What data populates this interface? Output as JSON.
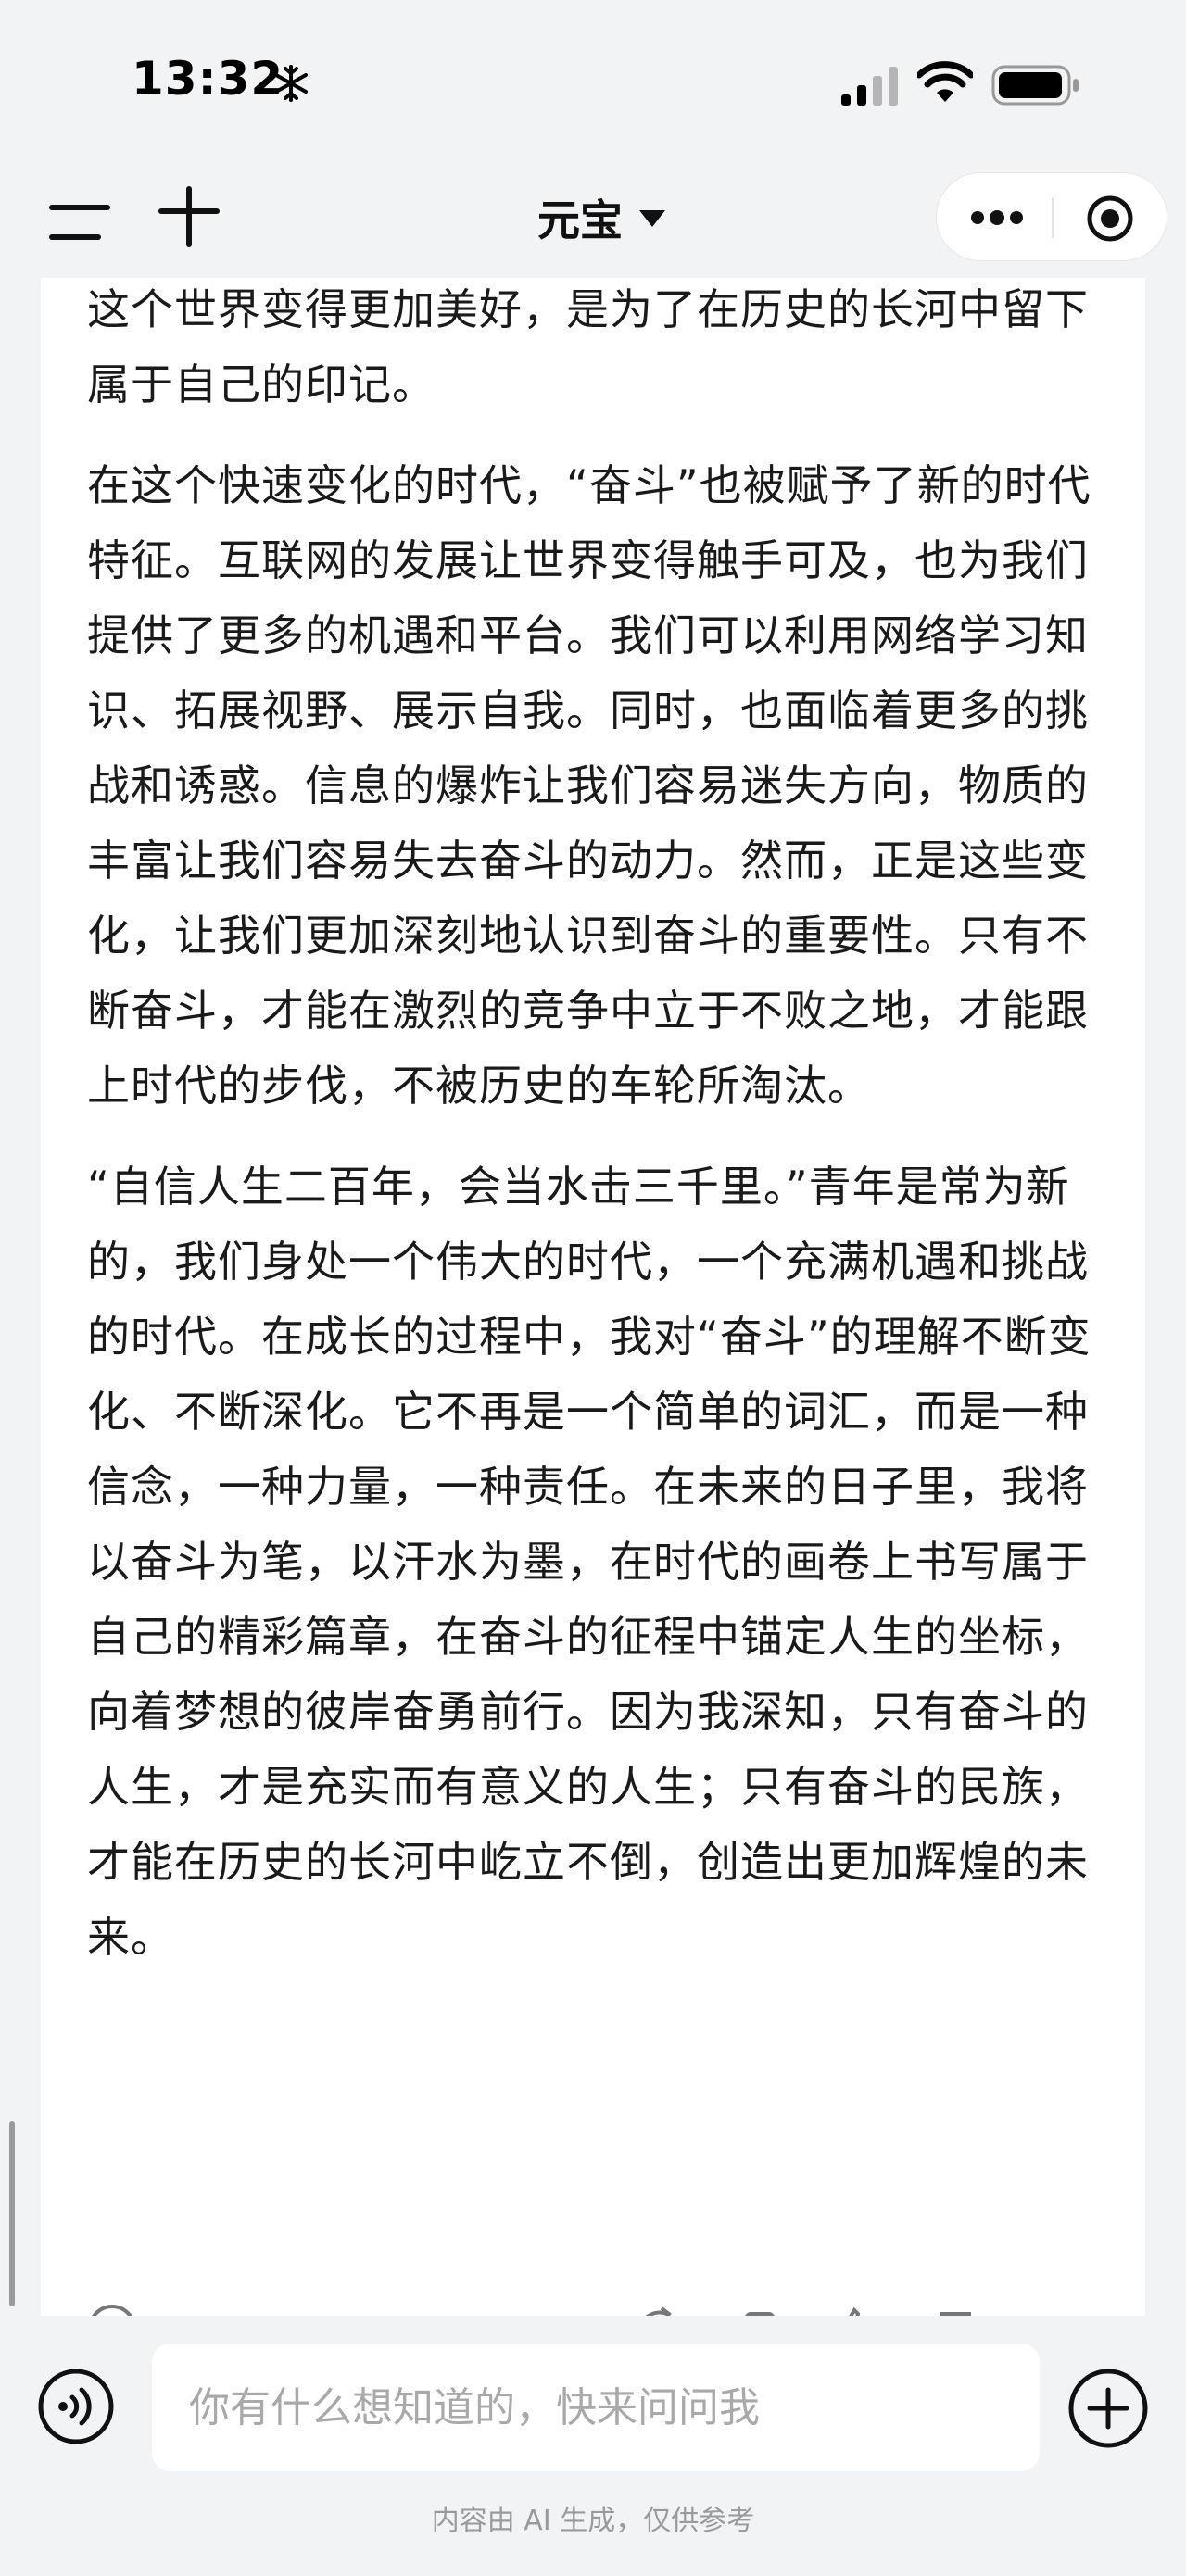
{
  "status_bar": {
    "time": "13:32",
    "snow_icon": "snowflake-icon",
    "signal_icon": "signal-icon",
    "wifi_icon": "wifi-icon",
    "battery_icon": "battery-icon"
  },
  "header": {
    "title": "元宝",
    "menu_icon": "menu-icon",
    "new_chat_icon": "plus-icon",
    "more_icon": "more-icon",
    "target_icon": "target-icon"
  },
  "content": {
    "paragraphs": [
      "这个世界变得更加美好，是为了在历史的长河中留下属于自己的印记。",
      "在这个快速变化的时代，“奋斗”也被赋予了新的时代特征。互联网的发展让世界变得触手可及，也为我们提供了更多的机遇和平台。我们可以利用网络学习知识、拓展视野、展示自我。同时，也面临着更多的挑战和诱惑。信息的爆炸让我们容易迷失方向，物质的丰富让我们容易失去奋斗的动力。然而，正是这些变化，让我们更加深刻地认识到奋斗的重要性。只有不断奋斗，才能在激烈的竞争中立于不败之地，才能跟上时代的步伐，不被历史的车轮所淘汰。",
      "“自信人生二百年，会当水击三千里。”青年是常为新的，我们身处一个伟大的时代，一个充满机遇和挑战的时代。在成长的过程中，我对“奋斗”的理解不断变化、不断深化。它不再是一个简单的词汇，而是一种信念，一种力量，一种责任。在未来的日子里，我将以奋斗为笔，以汗水为墨，在时代的画卷上书写属于自己的精彩篇章，在奋斗的征程中锚定人生的坐标，向着梦想的彼岸奋勇前行。因为我深知，只有奋斗的人生，才是充实而有意义的人生；只有奋斗的民族，才能在历史的长河中屹立不倒，创造出更加辉煌的未来。"
    ]
  },
  "input": {
    "placeholder": "你有什么想知道的，快来问问我",
    "voice_icon": "voice-icon",
    "add_icon": "add-icon"
  },
  "footer": {
    "disclaimer": "内容由 AI 生成，仅供参考"
  }
}
